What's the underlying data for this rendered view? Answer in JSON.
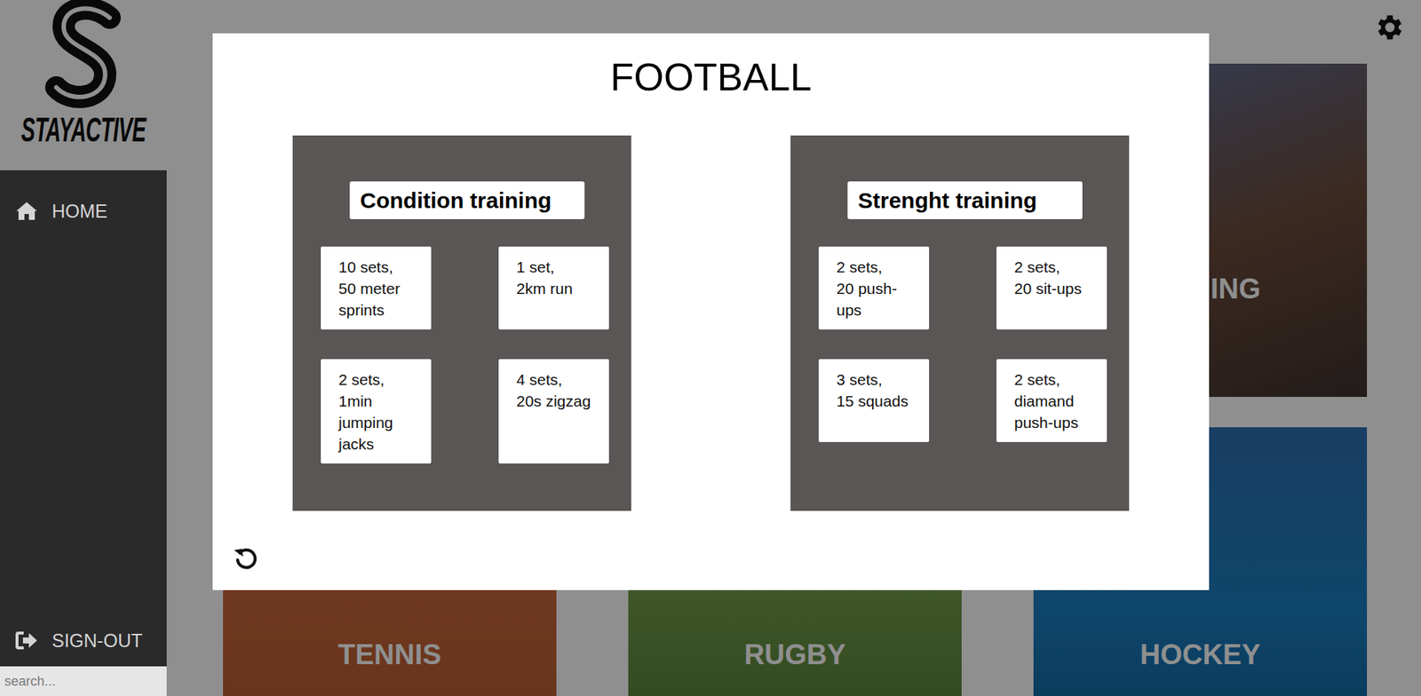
{
  "app": {
    "logo_text": "STAYACTIVE"
  },
  "sidebar": {
    "items": [
      {
        "label": "HOME"
      }
    ],
    "footer_item": {
      "label": "SIGN-OUT"
    }
  },
  "search": {
    "placeholder": "search..."
  },
  "background_cards": [
    {
      "label": "ING"
    },
    {
      "label": "TENNIS"
    },
    {
      "label": "RUGBY"
    },
    {
      "label": "HOCKEY"
    }
  ],
  "modal": {
    "title": "FOOTBALL",
    "panels": [
      {
        "title": "Condition training",
        "exercises": [
          {
            "sets": "10 sets,",
            "task": "50 meter sprints"
          },
          {
            "sets": "1 set,",
            "task": "2km run"
          },
          {
            "sets": "2 sets,",
            "task": "1min jumping jacks"
          },
          {
            "sets": "4 sets,",
            "task": "20s zigzag"
          }
        ]
      },
      {
        "title": "Strenght training",
        "exercises": [
          {
            "sets": "2 sets,",
            "task": "20 push-ups"
          },
          {
            "sets": "2 sets,",
            "task": "20 sit-ups"
          },
          {
            "sets": "3 sets,",
            "task": "15 squads"
          },
          {
            "sets": "2 sets,",
            "task": "diamand push-ups"
          }
        ]
      }
    ]
  }
}
